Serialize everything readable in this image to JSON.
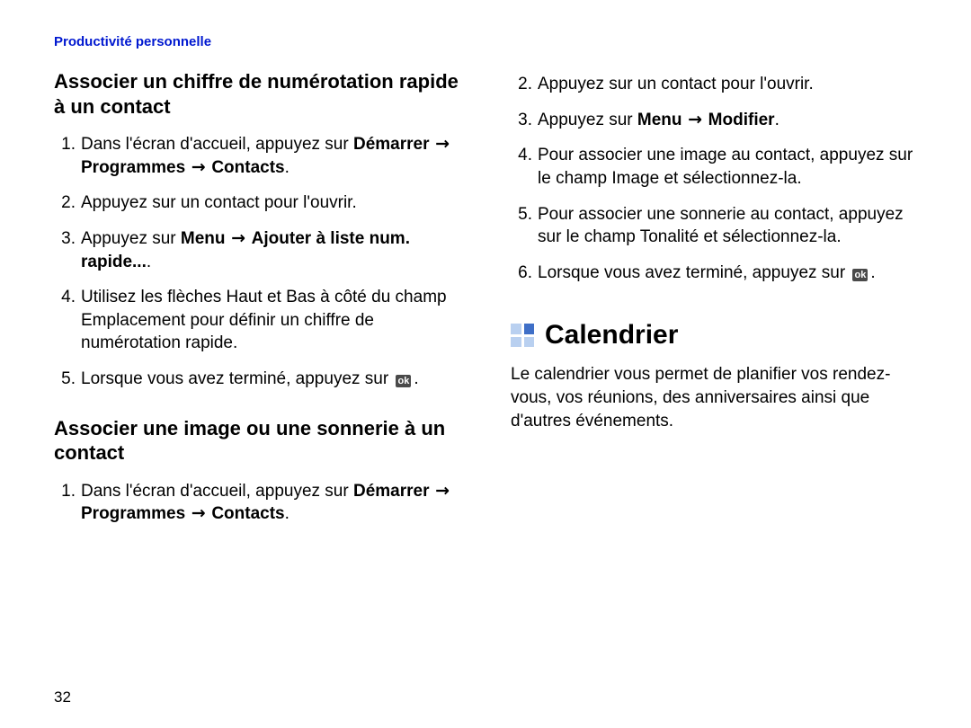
{
  "running_head": "Productivité personnelle",
  "page_number": "32",
  "left": {
    "heading1": "Associer un chiffre de numérotation rapide à un contact",
    "steps1": {
      "s1_a": "Dans l'écran d'accueil, appuyez sur ",
      "s1_b": "Démarrer",
      "s1_c": " → ",
      "s1_d": "Programmes",
      "s1_e": " → ",
      "s1_f": "Contacts",
      "s1_g": ".",
      "s2": "Appuyez sur un contact pour l'ouvrir.",
      "s3_a": "Appuyez sur ",
      "s3_b": "Menu",
      "s3_c": " → ",
      "s3_d": "Ajouter à liste num. rapide...",
      "s3_e": ".",
      "s4": "Utilisez les flèches Haut et Bas à côté du champ Emplacement pour définir un chiffre de numérotation rapide.",
      "s5_a": "Lorsque vous avez terminé, appuyez sur ",
      "s5_b": "."
    },
    "heading2": "Associer une image ou une sonnerie à un contact",
    "steps2": {
      "s1_a": "Dans l'écran d'accueil, appuyez sur ",
      "s1_b": "Démarrer",
      "s1_c": " → ",
      "s1_d": "Programmes",
      "s1_e": " → ",
      "s1_f": "Contacts",
      "s1_g": "."
    }
  },
  "right": {
    "steps_cont": {
      "s2": "Appuyez sur un contact pour l'ouvrir.",
      "s3_a": "Appuyez sur ",
      "s3_b": "Menu",
      "s3_c": " → ",
      "s3_d": "Modifier",
      "s3_e": ".",
      "s4": "Pour associer une image au contact, appuyez sur le champ Image et sélectionnez-la.",
      "s5": "Pour associer une sonnerie au contact, appuyez sur le champ Tonalité et sélectionnez-la.",
      "s6_a": "Lorsque vous avez terminé, appuyez sur ",
      "s6_b": "."
    },
    "section_title": "Calendrier",
    "section_text": "Le calendrier vous permet de planifier vos rendez-vous, vos réunions, des anniversaires ainsi que d'autres événements."
  },
  "ok_label": "ok"
}
